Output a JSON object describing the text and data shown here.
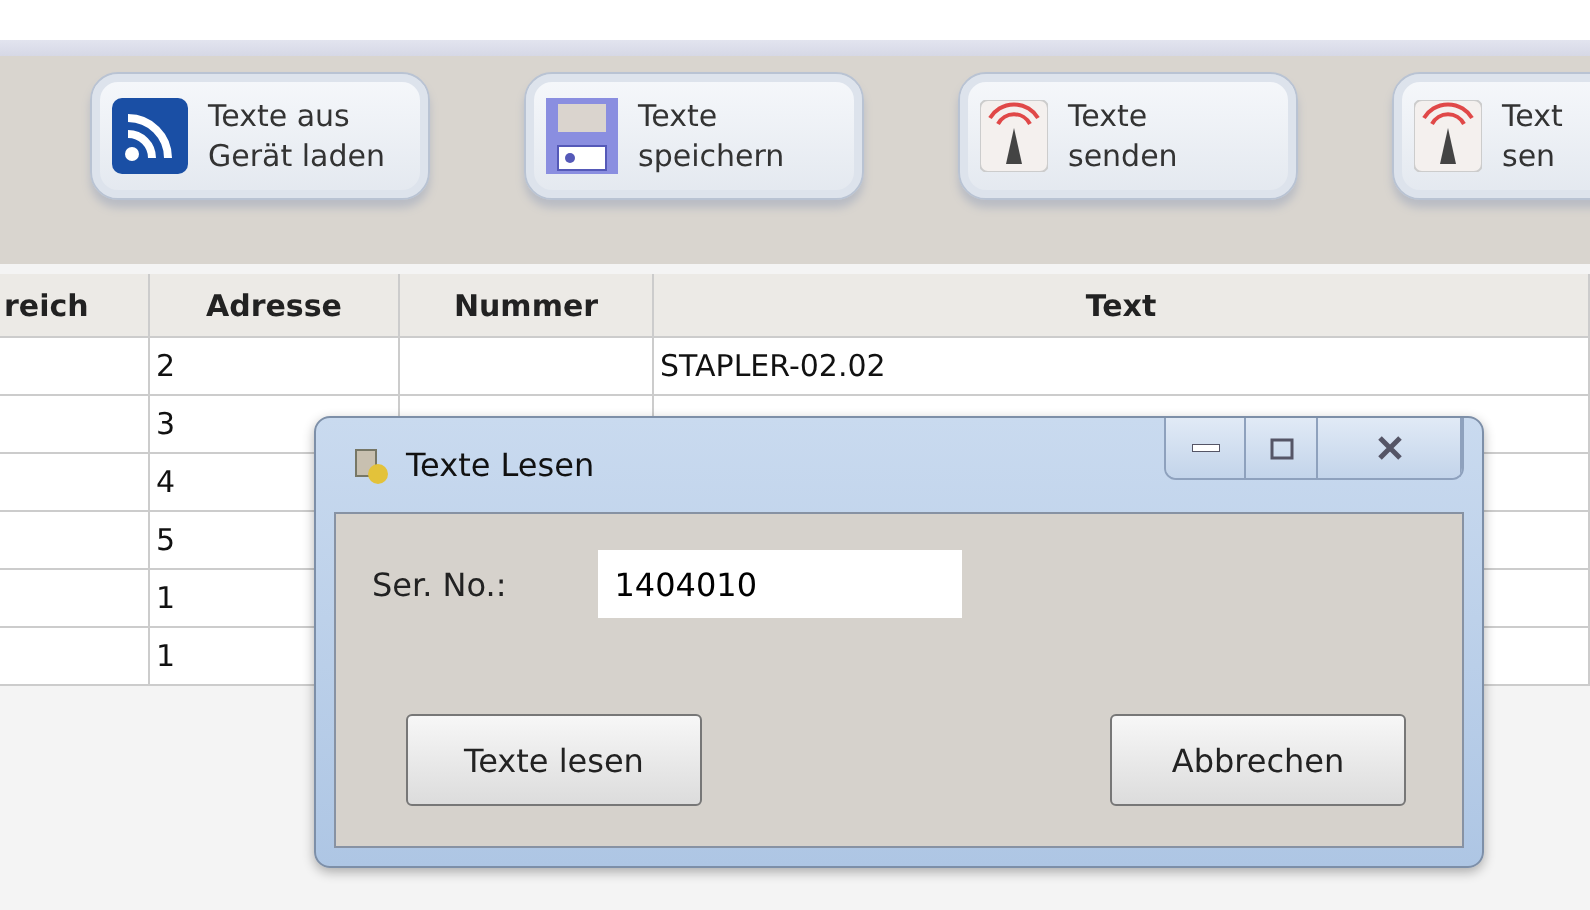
{
  "toolbar": {
    "buttons": [
      {
        "kind": "rss",
        "lines": [
          "Texte aus",
          "Gerät laden"
        ]
      },
      {
        "kind": "disk",
        "lines": [
          "Texte",
          "speichern"
        ]
      },
      {
        "kind": "antenna",
        "lines": [
          "Texte",
          "senden"
        ]
      },
      {
        "kind": "antenna",
        "lines": [
          "Text",
          "sen"
        ]
      }
    ]
  },
  "table": {
    "columns": [
      "reich",
      "Adresse",
      "Nummer",
      "Text"
    ],
    "rows": [
      [
        "",
        "2",
        "",
        "STAPLER-02.02"
      ],
      [
        "",
        "3",
        "",
        ""
      ],
      [
        "",
        "4",
        "",
        ""
      ],
      [
        "",
        "5",
        "",
        ""
      ],
      [
        "",
        "1",
        "",
        ""
      ],
      [
        "",
        "1",
        "",
        ""
      ]
    ]
  },
  "dialog": {
    "title": "Texte Lesen",
    "field_label": "Ser. No.:",
    "field_value": "1404010",
    "buttons": [
      "Texte lesen",
      "Abbrechen"
    ]
  }
}
